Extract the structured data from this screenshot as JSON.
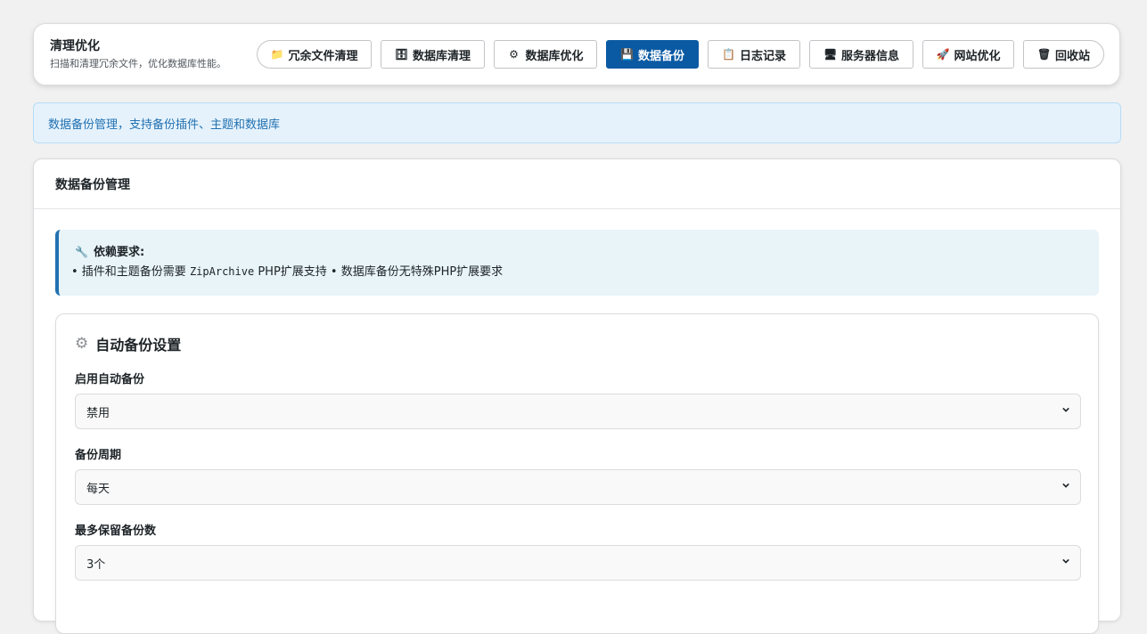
{
  "header": {
    "title": "清理优化",
    "subtitle": "扫描和清理冗余文件，优化数据库性能。"
  },
  "tabs": [
    {
      "label": "冗余文件清理",
      "icon": "folder-icon",
      "glyph": "📁",
      "active": false
    },
    {
      "label": "数据库清理",
      "icon": "database-icon",
      "glyph": "🗄",
      "active": false
    },
    {
      "label": "数据库优化",
      "icon": "gear-icon",
      "glyph": "⚙",
      "active": false
    },
    {
      "label": "数据备份",
      "icon": "floppy-disk-icon",
      "glyph": "💾",
      "active": true
    },
    {
      "label": "日志记录",
      "icon": "clipboard-icon",
      "glyph": "📋",
      "active": false
    },
    {
      "label": "服务器信息",
      "icon": "monitor-icon",
      "glyph": "🖥",
      "active": false
    },
    {
      "label": "网站优化",
      "icon": "rocket-icon",
      "glyph": "🚀",
      "active": false
    },
    {
      "label": "回收站",
      "icon": "trash-icon",
      "glyph": "🗑",
      "active": false
    }
  ],
  "notice": {
    "text": "数据备份管理，支持备份插件、主题和数据库"
  },
  "card": {
    "title": "数据备份管理",
    "deps": {
      "icon": "wrench-icon",
      "title": "依赖要求:",
      "body_prefix": "• 插件和主题备份需要",
      "body_code": "ZipArchive",
      "body_suffix": "PHP扩展支持 • 数据库备份无特殊PHP扩展要求"
    },
    "settings": {
      "icon": "gear-icon",
      "title": "自动备份设置",
      "fields": [
        {
          "label": "启用自动备份",
          "value": "禁用"
        },
        {
          "label": "备份周期",
          "value": "每天"
        },
        {
          "label": "最多保留备份数",
          "value": "3个"
        }
      ]
    }
  },
  "colors": {
    "active_tab": "#0a5aa3",
    "notice_bg": "#e5f2fc",
    "notice_text": "#2271b1",
    "deps_bg": "#e8f4f8",
    "deps_border": "#2271b1"
  }
}
